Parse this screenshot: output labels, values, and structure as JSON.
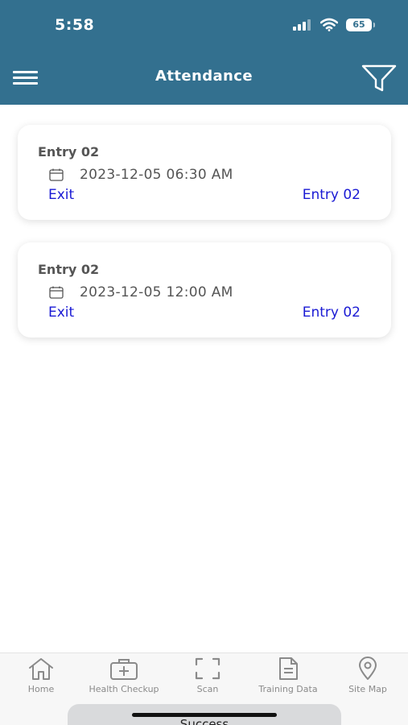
{
  "status_bar": {
    "time": "5:58",
    "battery": "65"
  },
  "header": {
    "title": "Attendance"
  },
  "records": [
    {
      "title": "Entry 02",
      "datetime": "2023-12-05 06:30 AM",
      "action": "Exit",
      "status": "Entry 02"
    },
    {
      "title": "Entry 02",
      "datetime": "2023-12-05 12:00 AM",
      "action": "Exit",
      "status": "Entry 02"
    }
  ],
  "tabbar": {
    "items": [
      {
        "label": "Home",
        "icon": "home-icon"
      },
      {
        "label": "Health Checkup",
        "icon": "medical-kit-icon"
      },
      {
        "label": "Scan",
        "icon": "scan-icon"
      },
      {
        "label": "Training Data",
        "icon": "document-icon"
      },
      {
        "label": "Site Map",
        "icon": "map-pin-icon"
      }
    ]
  },
  "toast": {
    "text": "Success"
  },
  "colors": {
    "header": "#33708f",
    "link": "#1a1ad4",
    "tab_icon": "#8a8a8a"
  }
}
